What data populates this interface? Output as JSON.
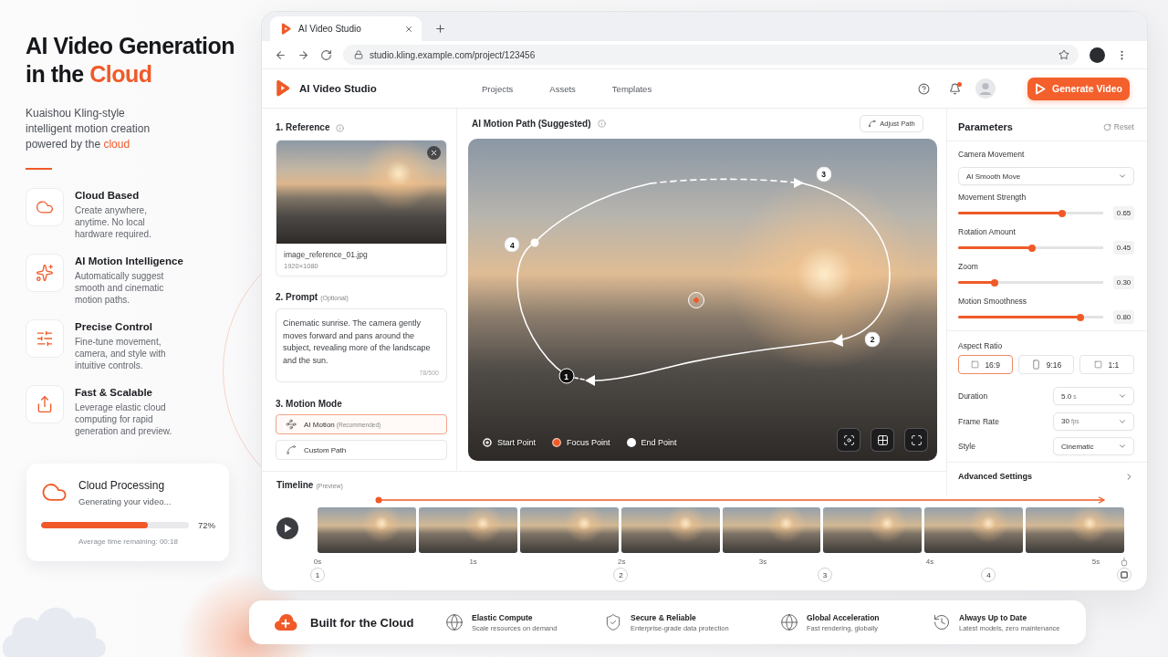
{
  "hero": {
    "title": "AI Video Generation in the",
    "title_highlight": "Cloud",
    "subtitle": "Kuaishou Kling-style intelligent motion creation powered by the",
    "subtitle_highlight": "cloud"
  },
  "features": [
    {
      "kind": "cloud",
      "title": "Cloud Based",
      "description": "Create anywhere, anytime. No local hardware required."
    },
    {
      "kind": "sparkle",
      "title": "AI Motion Intelligence",
      "description": "Automatically suggest smooth and cinematic motion paths."
    },
    {
      "kind": "sliders",
      "title": "Precise Control",
      "description": "Fine-tune movement, camera, and style with intuitive controls."
    },
    {
      "kind": "upload",
      "title": "Fast & Scalable",
      "description": "Leverage elastic cloud computing for rapid generation and preview."
    }
  ],
  "processing": {
    "title": "Cloud Processing",
    "status": "Generating your video...",
    "level": 0.72,
    "percent": "72%",
    "eta": "Average time remaining: 00:18"
  },
  "browser": {
    "tabs": [
      {
        "title": "AI Video Studio",
        "selected": true
      }
    ],
    "url": "studio.kling.example.com/project/123456"
  },
  "app": {
    "name": "AI Video Studio",
    "nav": [
      {
        "label": "Projects"
      },
      {
        "label": "Assets"
      },
      {
        "label": "Templates"
      }
    ],
    "unread_notifications": true,
    "generate_button": "Generate Video"
  },
  "reference": {
    "title": "1. Reference",
    "file_name": "image_reference_01.jpg",
    "dimensions": "1920×1080"
  },
  "prompt": {
    "title": "2. Prompt",
    "hint": "(Optional)",
    "value": "Cinematic sunrise. The camera gently moves forward and pans around the subject, revealing more of the landscape and the sun.",
    "counter": "78/500"
  },
  "motion_mode": {
    "title": "3. Motion Mode",
    "options": [
      {
        "kind": "ai",
        "label": "AI Motion",
        "note": "(Recommended)",
        "selected": true
      },
      {
        "kind": "custom",
        "label": "Custom Path",
        "selected": false
      }
    ]
  },
  "preview": {
    "title": "AI Motion Path (Suggested)",
    "adjust_button": "Adjust Path",
    "points": [
      {
        "kind": "start",
        "label": "1"
      },
      {
        "kind": "waypoint",
        "label": "2"
      },
      {
        "kind": "waypoint",
        "label": "3"
      },
      {
        "kind": "waypoint",
        "label": "4"
      }
    ],
    "legend": [
      {
        "kind": "start",
        "label": "Start Point"
      },
      {
        "kind": "focus",
        "label": "Focus Point"
      },
      {
        "kind": "end",
        "label": "End Point"
      }
    ],
    "tools": [
      {
        "kind": "focus"
      },
      {
        "kind": "grid"
      },
      {
        "kind": "fullscreen"
      }
    ]
  },
  "parameters": {
    "title": "Parameters",
    "reset": "Reset",
    "camera_movement": {
      "label": "Camera Movement",
      "value": "AI Smooth Move"
    },
    "sliders": [
      {
        "label": "Movement Strength",
        "level": 0.72,
        "reading": "0.65"
      },
      {
        "label": "Rotation Amount",
        "level": 0.51,
        "reading": "0.45"
      },
      {
        "label": "Zoom",
        "level": 0.25,
        "reading": "0.30"
      },
      {
        "label": "Motion Smoothness",
        "level": 0.84,
        "reading": "0.80"
      }
    ],
    "aspect_ratio": {
      "label": "Aspect Ratio",
      "options": [
        {
          "kind": "landscape",
          "label": "16:9",
          "selected": true
        },
        {
          "kind": "portrait",
          "label": "9:16",
          "selected": false
        },
        {
          "kind": "square",
          "label": "1:1",
          "selected": false
        }
      ]
    },
    "selects": [
      {
        "label": "Duration",
        "value": "5.0",
        "unit": "s"
      },
      {
        "label": "Frame Rate",
        "value": "30",
        "unit": "fps"
      },
      {
        "label": "Style",
        "value": "Cinematic"
      }
    ],
    "advanced": "Advanced Settings"
  },
  "timeline": {
    "title": "Timeline",
    "hint": "(Preview)",
    "ticks": [
      "0s",
      "1s",
      "2s",
      "3s",
      "4s",
      "5s"
    ],
    "markers": [
      {
        "kind": "keyframe",
        "label": "1"
      },
      {
        "kind": "keyframe",
        "label": "2"
      },
      {
        "kind": "keyframe",
        "label": "3"
      },
      {
        "kind": "keyframe",
        "label": "4"
      },
      {
        "kind": "end"
      }
    ]
  },
  "footer": {
    "title": "Built for the Cloud",
    "items": [
      {
        "kind": "globe",
        "title": "Elastic Compute",
        "description": "Scale resources on demand"
      },
      {
        "kind": "shield",
        "title": "Secure & Reliable",
        "description": "Enterprise-grade data protection"
      },
      {
        "kind": "globe",
        "title": "Global Acceleration",
        "description": "Fast rendering, globally"
      },
      {
        "kind": "refresh",
        "title": "Always Up to Date",
        "description": "Latest models, zero maintenance"
      }
    ]
  }
}
